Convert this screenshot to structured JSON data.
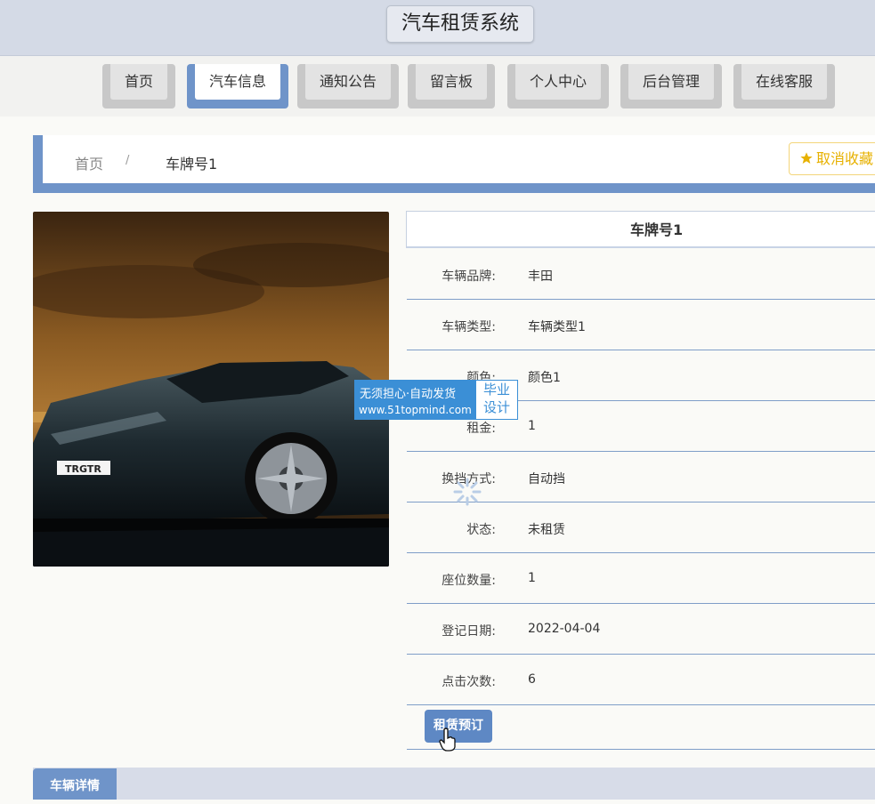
{
  "site": {
    "title": "汽车租赁系统"
  },
  "nav": {
    "items": [
      {
        "label": "首页"
      },
      {
        "label": "汽车信息"
      },
      {
        "label": "通知公告"
      },
      {
        "label": "留言板"
      },
      {
        "label": "个人中心"
      },
      {
        "label": "后台管理"
      },
      {
        "label": "在线客服"
      }
    ],
    "active": "汽车信息"
  },
  "breadcrumb": {
    "home": "首页",
    "separator": "/",
    "current": "车牌号1"
  },
  "favorite": {
    "label": "取消收藏"
  },
  "detail": {
    "title": "车牌号1",
    "fields": [
      {
        "label": "车辆品牌:",
        "value": "丰田"
      },
      {
        "label": "车辆类型:",
        "value": "车辆类型1"
      },
      {
        "label": "颜色:",
        "value": "颜色1"
      },
      {
        "label": "租金:",
        "value": "1"
      },
      {
        "label": "换挡方式:",
        "value": "自动挡"
      },
      {
        "label": "状态:",
        "value": "未租赁"
      },
      {
        "label": "座位数量:",
        "value": "1"
      },
      {
        "label": "登记日期:",
        "value": "2022-04-04"
      },
      {
        "label": "点击次数:",
        "value": "6"
      }
    ],
    "rent_button": "租赁预订"
  },
  "car_image": {
    "plate_text": "TRGTR"
  },
  "tabs": {
    "detail": "车辆详情"
  },
  "watermark": {
    "line1": "无须担心·自动发货",
    "line2": "www.51topmind.com",
    "side1": "毕业",
    "side2": "设计"
  },
  "colors": {
    "accent": "#6f94c9",
    "button": "#5e88c4",
    "favorite": "#e7b100",
    "header": "#d4dae6"
  }
}
